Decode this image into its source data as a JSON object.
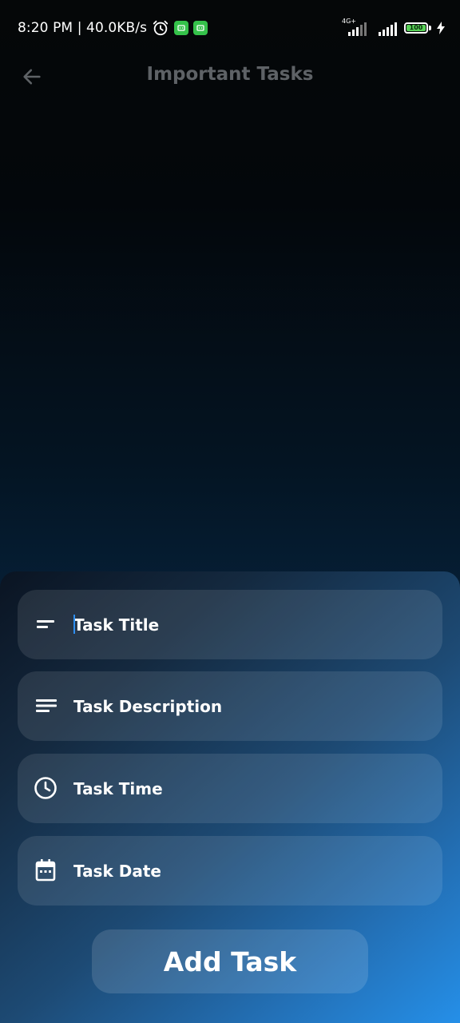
{
  "status_bar": {
    "time_speed": "8:20 PM | 40.0KB/s",
    "network_type": "4G+",
    "battery_level": "100",
    "icons": [
      "alarm-icon",
      "app-notification-icon",
      "app-notification-icon",
      "signal-icon",
      "signal-icon",
      "battery-icon",
      "charging-bolt-icon"
    ],
    "badge_color": "#35c24a",
    "battery_color": "#57d156"
  },
  "app_bar": {
    "title": "Important Tasks",
    "back_icon": "arrow-left-icon",
    "title_color": "#5e6266"
  },
  "form": {
    "fields": [
      {
        "id": "title",
        "placeholder": "Task Title",
        "icon": "short-text-icon",
        "value": ""
      },
      {
        "id": "description",
        "placeholder": "Task Description",
        "icon": "notes-icon",
        "value": ""
      },
      {
        "id": "time",
        "placeholder": "Task Time",
        "icon": "clock-icon",
        "value": ""
      },
      {
        "id": "date",
        "placeholder": "Task Date",
        "icon": "calendar-icon",
        "value": ""
      }
    ],
    "submit_label": "Add Task",
    "caret_color": "#2f8ff0"
  }
}
